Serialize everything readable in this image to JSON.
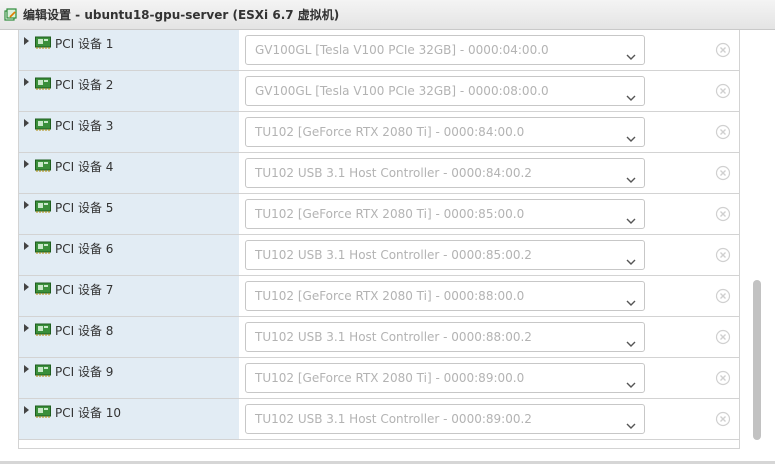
{
  "window": {
    "title": "编辑设置 - ubuntu18-gpu-server (ESXi 6.7 虚拟机)"
  },
  "colors": {
    "label_cell_bg": "#e2ecf4",
    "placeholder_text": "#b3b3b3",
    "border": "#d3d3d3"
  },
  "devices": [
    {
      "label": "PCI 设备 1",
      "value": "GV100GL [Tesla V100 PCIe 32GB] - 0000:04:00.0"
    },
    {
      "label": "PCI 设备 2",
      "value": "GV100GL [Tesla V100 PCIe 32GB] - 0000:08:00.0"
    },
    {
      "label": "PCI 设备 3",
      "value": "TU102 [GeForce RTX 2080 Ti] - 0000:84:00.0"
    },
    {
      "label": "PCI 设备 4",
      "value": "TU102 USB 3.1 Host Controller - 0000:84:00.2"
    },
    {
      "label": "PCI 设备 5",
      "value": "TU102 [GeForce RTX 2080 Ti] - 0000:85:00.0"
    },
    {
      "label": "PCI 设备 6",
      "value": "TU102 USB 3.1 Host Controller - 0000:85:00.2"
    },
    {
      "label": "PCI 设备 7",
      "value": "TU102 [GeForce RTX 2080 Ti] - 0000:88:00.0"
    },
    {
      "label": "PCI 设备 8",
      "value": "TU102 USB 3.1 Host Controller - 0000:88:00.2"
    },
    {
      "label": "PCI 设备 9",
      "value": "TU102 [GeForce RTX 2080 Ti] - 0000:89:00.0"
    },
    {
      "label": "PCI 设备 10",
      "value": "TU102 USB 3.1 Host Controller - 0000:89:00.2"
    }
  ]
}
